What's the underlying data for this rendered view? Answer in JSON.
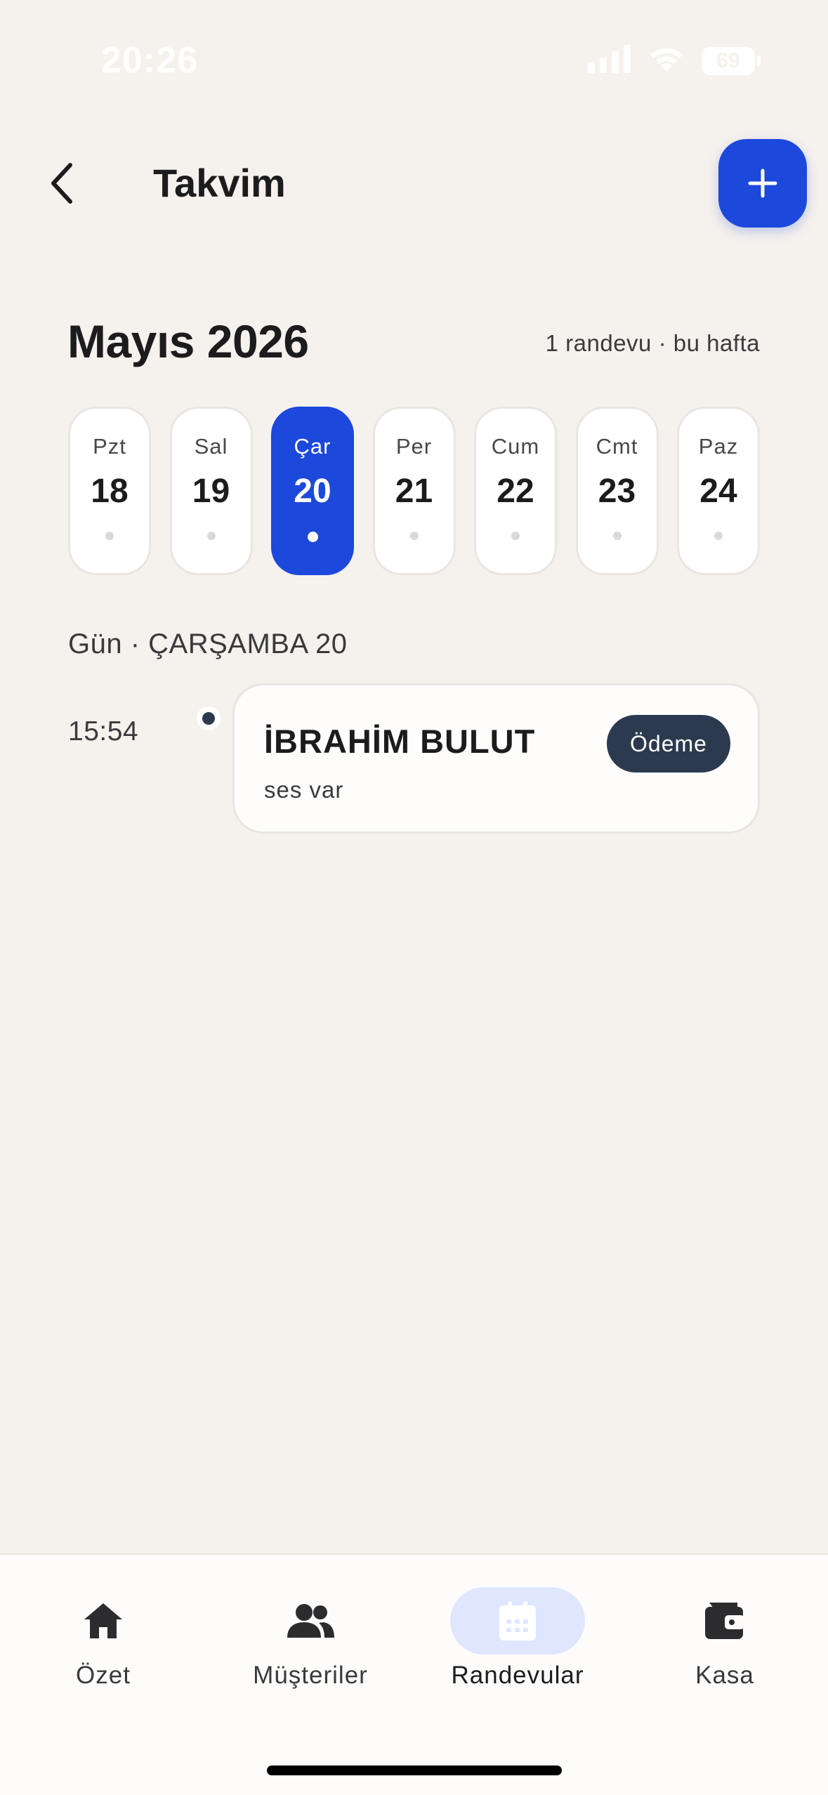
{
  "status_bar": {
    "time": "20:26",
    "battery": "69"
  },
  "header": {
    "title": "Takvim",
    "back_icon": "chevron-left-icon",
    "add_icon": "plus-icon"
  },
  "calendar": {
    "month_title": "Mayıs 2026",
    "week_summary": "1 randevu · bu hafta",
    "days": [
      {
        "abbr": "Pzt",
        "num": "18",
        "selected": false
      },
      {
        "abbr": "Sal",
        "num": "19",
        "selected": false
      },
      {
        "abbr": "Çar",
        "num": "20",
        "selected": true
      },
      {
        "abbr": "Per",
        "num": "21",
        "selected": false
      },
      {
        "abbr": "Cum",
        "num": "22",
        "selected": false
      },
      {
        "abbr": "Cmt",
        "num": "23",
        "selected": false
      },
      {
        "abbr": "Paz",
        "num": "24",
        "selected": false
      }
    ]
  },
  "day_view": {
    "heading": "Gün · ÇARŞAMBA 20",
    "appointments": [
      {
        "time": "15:54",
        "name": "İBRAHİM BULUT",
        "note": "ses var",
        "badge": "Ödeme"
      }
    ]
  },
  "tab_bar": {
    "tabs": [
      {
        "label": "Özet",
        "icon": "home-icon",
        "active": false
      },
      {
        "label": "Müşteriler",
        "icon": "users-icon",
        "active": false
      },
      {
        "label": "Randevular",
        "icon": "calendar-icon",
        "active": true
      },
      {
        "label": "Kasa",
        "icon": "wallet-icon",
        "active": false
      }
    ]
  },
  "colors": {
    "accent": "#1c48dc",
    "background": "#f5f1ed",
    "badge": "#2c3a4f",
    "active_tab_pill": "#dfe6ff"
  }
}
